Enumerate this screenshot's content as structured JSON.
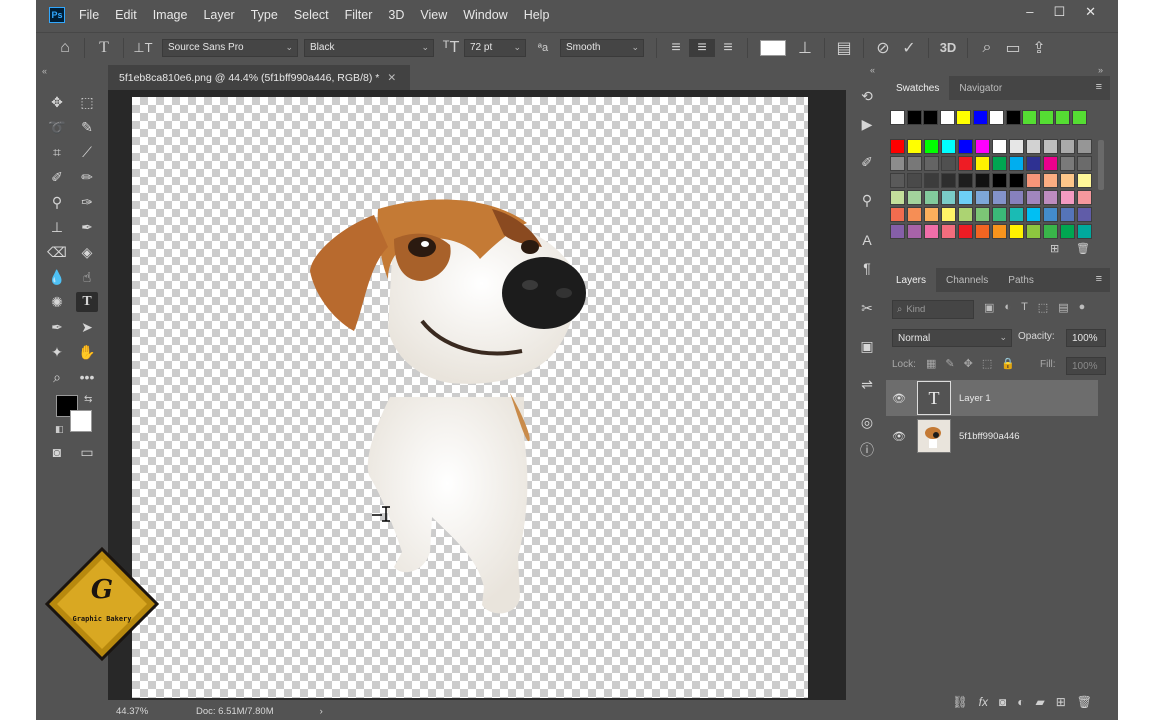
{
  "menubar": {
    "logo": "Ps",
    "items": [
      "File",
      "Edit",
      "Image",
      "Layer",
      "Type",
      "Select",
      "Filter",
      "3D",
      "View",
      "Window",
      "Help"
    ],
    "window_controls": [
      "minimize-icon",
      "maximize-icon",
      "close-icon"
    ]
  },
  "options": {
    "font_family": "Source Sans Pro",
    "font_style": "Black",
    "font_size": "72 pt",
    "anti_alias": "Smooth",
    "text_color": "#ffffff"
  },
  "document": {
    "tab_title": "5f1eb8ca810e6.png @ 44.4% (5f1bff990a446, RGB/8) *",
    "close_glyph": "✕"
  },
  "status": {
    "zoom": "44.37%",
    "doc_info": "Doc: 6.51M/7.80M"
  },
  "swatches_panel": {
    "tabs": [
      "Swatches",
      "Navigator"
    ],
    "recent": [
      "#ffffff",
      "#000000",
      "#000000",
      "#ffffff",
      "#ffff00",
      "#0000ff",
      "#ffffff",
      "#000000",
      "#55dd33",
      "#55dd33",
      "#55dd33",
      "#55dd33"
    ],
    "grid": [
      [
        "#ff0000",
        "#ffff00",
        "#00ff00",
        "#00ffff",
        "#0000ff",
        "#ff00ff",
        "#ffffff",
        "#e6e6e6",
        "#d2d2d2",
        "#bebebe",
        "#aaaaaa",
        "#969696"
      ],
      [
        "#8c8c8c",
        "#787878",
        "#646464",
        "#505050",
        "#ee1c24",
        "#fff200",
        "#00a651",
        "#00aeef",
        "#2e3192",
        "#ec008c",
        "#7a7a7a",
        "#6b6b6b"
      ],
      [
        "#5a5a5a",
        "#4a4a4a",
        "#3c3c3c",
        "#2e2e2e",
        "#1e1e1e",
        "#111111",
        "#000000",
        "#000000",
        "#f79679",
        "#fbad82",
        "#fdc68a",
        "#fff799"
      ],
      [
        "#c4df9b",
        "#a3d39c",
        "#82ca9c",
        "#7accc8",
        "#6dcff6",
        "#7da7d8",
        "#8393ca",
        "#8781bd",
        "#a186be",
        "#bd8cbf",
        "#f49ac1",
        "#f5989d"
      ],
      [
        "#f26c4f",
        "#f68e55",
        "#fbaf5c",
        "#fff467",
        "#acd372",
        "#7cc576",
        "#3bb878",
        "#1abbb4",
        "#00bff3",
        "#438ccb",
        "#5574b9",
        "#605ca8"
      ],
      [
        "#855fa8",
        "#a763a8",
        "#f06ea9",
        "#f26d7d",
        "#ed1c24",
        "#f26522",
        "#f7941d",
        "#fff200",
        "#8dc63f",
        "#39b54a",
        "#00a651",
        "#00a99d"
      ]
    ]
  },
  "layers_panel": {
    "tabs": [
      "Layers",
      "Channels",
      "Paths"
    ],
    "filter_placeholder": "Kind",
    "blend_mode": "Normal",
    "opacity_label": "Opacity:",
    "opacity_value": "100%",
    "lock_label": "Lock:",
    "fill_label": "Fill:",
    "fill_value": "100%",
    "layers": [
      {
        "name": "Layer 1",
        "type": "text",
        "thumb": "T",
        "selected": true
      },
      {
        "name": "5f1bff990a446",
        "type": "smart-object",
        "selected": false
      }
    ]
  },
  "watermark": {
    "letter": "G",
    "text": "Graphic Bakery"
  },
  "colors": {
    "foreground": "#000000",
    "background": "#ffffff",
    "ui_bg": "#535353",
    "canvas_bg": "#282828"
  }
}
